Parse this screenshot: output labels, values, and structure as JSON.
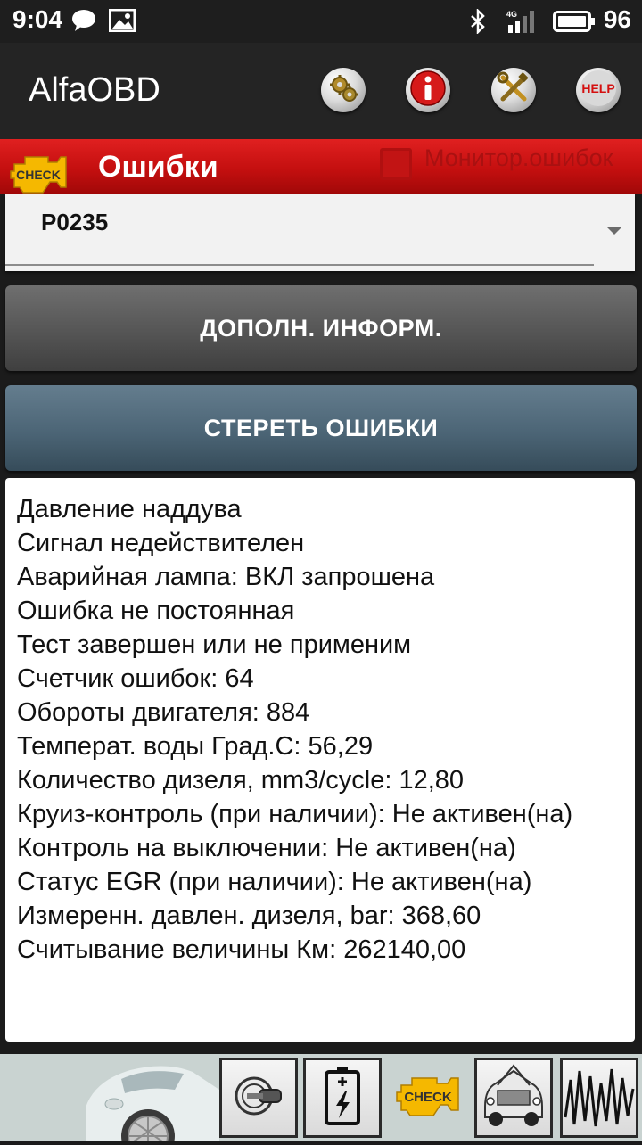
{
  "status_bar": {
    "time": "9:04",
    "network": "4G",
    "battery": "96"
  },
  "app_bar": {
    "title": "AlfaOBD",
    "buttons": [
      {
        "name": "settings",
        "icon": "gears-icon",
        "label": ""
      },
      {
        "name": "info",
        "icon": "info-icon",
        "label": "i"
      },
      {
        "name": "tools",
        "icon": "tools-icon",
        "label": ""
      },
      {
        "name": "help",
        "icon": "help-icon",
        "label": "HELP"
      }
    ]
  },
  "error_header": {
    "title": "Ошибки",
    "badge": "CHECK",
    "monitor_label": "Монитор.ошибок",
    "monitor_checked": false
  },
  "dropdown": {
    "selected": "P0235"
  },
  "actions": {
    "info_label": "ДОПОЛН. ИНФОРМ.",
    "clear_label": "СТЕРЕТЬ ОШИБКИ"
  },
  "details": {
    "lines": [
      "Давление наддува",
      "Сигнал недействителен",
      "Аварийная лампа: ВКЛ запрошена",
      "Ошибка не постоянная",
      "Тест завершен или не применим",
      "Счетчик ошибок: 64",
      "Обороты двигателя: 884",
      "Температ. воды Град.С: 56,29",
      "Количество дизеля, mm3/cycle: 12,80",
      "Круиз-контроль (при наличии): Не активен(на)",
      "Контроль на выключении: Не активен(на)",
      "Статус EGR (при наличии): Не активен(на)",
      "Измеренн. давлен. дизеля, bar: 368,60",
      "Считывание величины Км: 262140,00"
    ]
  },
  "bottom_bar": {
    "check_label": "CHECK",
    "items": [
      "key-icon",
      "battery-icon",
      "check-engine-icon",
      "car-hood-icon",
      "waveform-icon"
    ]
  },
  "colors": {
    "header_red": "#c40f0f",
    "appbar": "#242424",
    "info_button": "#555555",
    "clear_button": "#4c6576",
    "check_yellow": "#f5b800"
  }
}
